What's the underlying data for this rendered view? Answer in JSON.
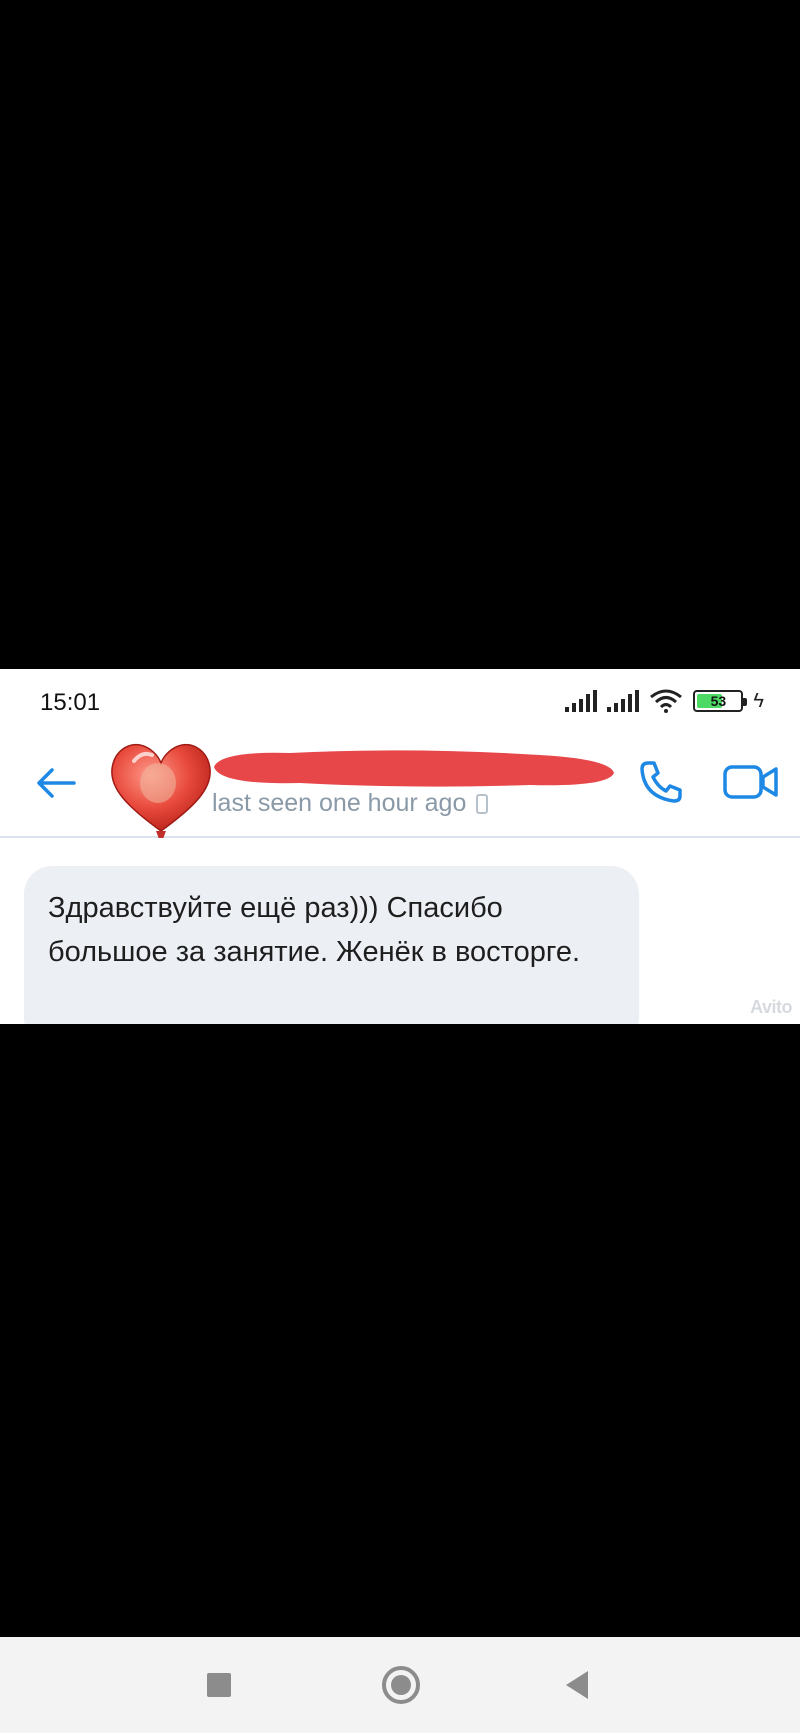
{
  "status_bar": {
    "time": "15:01",
    "battery_level": "53",
    "battery_color": "#4cd964"
  },
  "header": {
    "last_seen": "last seen one hour ago",
    "redaction_color": "#e8474a",
    "accent": "#1e88e5"
  },
  "messages": [
    {
      "text": "Здравствуйте ещё раз))) Спасибо большое за занятие. Женёк в восторге."
    }
  ],
  "watermark": "Avito",
  "nav": {
    "icons": [
      "recents-square-icon",
      "home-circle-icon",
      "back-triangle-icon"
    ]
  }
}
